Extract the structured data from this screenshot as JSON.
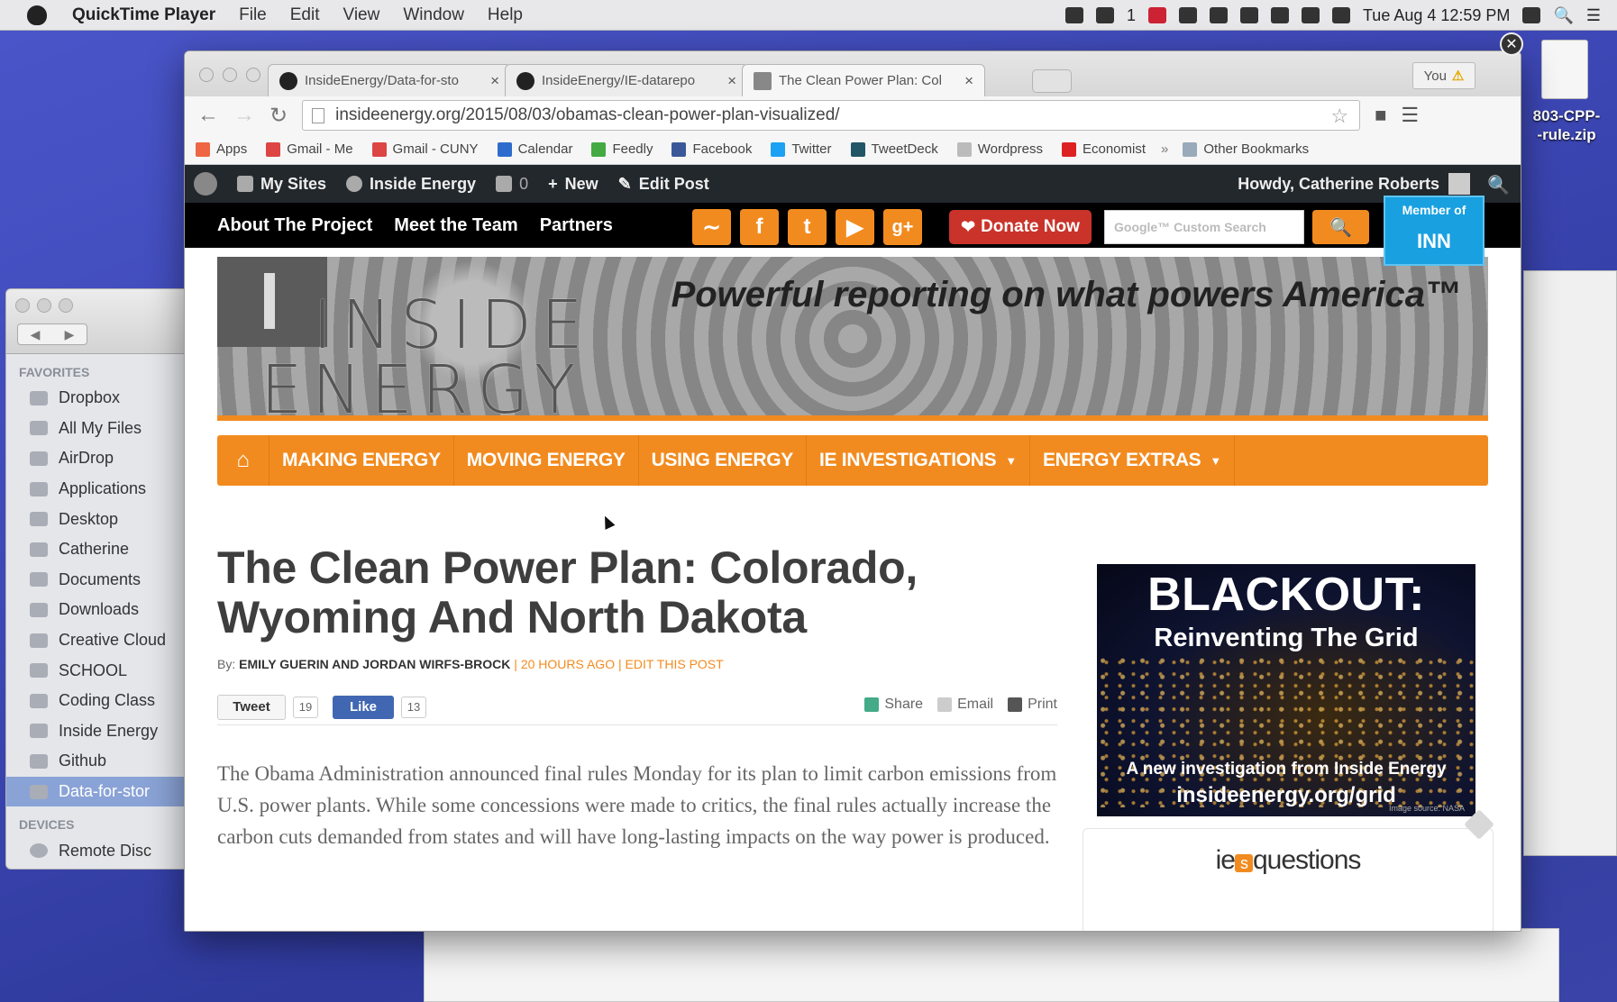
{
  "menubar": {
    "app_name": "QuickTime Player",
    "menus": [
      "File",
      "Edit",
      "View",
      "Window",
      "Help"
    ],
    "clock": "Tue Aug 4  12:59 PM",
    "tray_badge": "1"
  },
  "desktop_file": {
    "label_line1": "803-CPP-",
    "label_line2": "-rule.zip"
  },
  "finder": {
    "favorites_header": "FAVORITES",
    "items": [
      "Dropbox",
      "All My Files",
      "AirDrop",
      "Applications",
      "Desktop",
      "Catherine",
      "Documents",
      "Downloads",
      "Creative Cloud",
      "SCHOOL",
      "Coding Class",
      "Inside Energy",
      "Github",
      "Data-for-stor"
    ],
    "devices_header": "DEVICES",
    "device": "Remote Disc"
  },
  "chrome": {
    "tabs": [
      {
        "title": "InsideEnergy/Data-for-sto"
      },
      {
        "title": "InsideEnergy/IE-datarepo"
      },
      {
        "title": "The Clean Power Plan: Col"
      }
    ],
    "profile": "You",
    "url": "insideenergy.org/2015/08/03/obamas-clean-power-plan-visualized/",
    "bookmarks": [
      "Apps",
      "Gmail - Me",
      "Gmail - CUNY",
      "Calendar",
      "Feedly",
      "Facebook",
      "Twitter",
      "TweetDeck",
      "Wordpress",
      "Economist"
    ],
    "bookmark_colors": [
      "#e64",
      "#d44",
      "#d44",
      "#2d6ccd",
      "#4a4",
      "#3b5998",
      "#1da1f2",
      "#256",
      "#bbb",
      "#d22"
    ],
    "other_bookmarks": "Other Bookmarks"
  },
  "wpbar": {
    "my_sites": "My Sites",
    "site": "Inside Energy",
    "comments": "0",
    "new": "New",
    "edit": "Edit Post",
    "howdy": "Howdy, Catherine Roberts"
  },
  "ienav": {
    "links": [
      "About The Project",
      "Meet the Team",
      "Partners"
    ],
    "donate": "Donate Now",
    "search_placeholder": "Google™ Custom Search",
    "member_of": "Member of",
    "inn": "INN"
  },
  "banner": {
    "wordmark_1": "INSIDE",
    "wordmark_2": "ENERGY",
    "tagline": "Powerful reporting on what powers America™"
  },
  "catnav": [
    "MAKING ENERGY",
    "MOVING ENERGY",
    "USING ENERGY",
    "IE INVESTIGATIONS",
    "ENERGY EXTRAS"
  ],
  "article": {
    "title": "The Clean Power Plan: Colorado, Wyoming And North Dakota",
    "by": "By:",
    "authors": "EMILY GUERIN AND JORDAN WIRFS-BROCK",
    "time": "20 HOURS AGO",
    "edit": "EDIT THIS POST",
    "tweet": "Tweet",
    "tweet_count": "19",
    "like": "Like",
    "like_count": "13",
    "share": "Share",
    "email": "Email",
    "print": "Print",
    "lede": "The Obama Administration announced final rules Monday for its plan to limit carbon emissions from U.S. power plants. While some concessions were made to critics, the final rules actually increase the carbon cuts demanded from states and will have long-lasting impacts on the way power is produced."
  },
  "sidebar_ad": {
    "title": "BLACKOUT:",
    "subtitle": "Reinventing The Grid",
    "line1": "A new investigation from Inside Energy",
    "line2": "insideenergy.org/grid",
    "credit": "Image source: NASA"
  },
  "questions": {
    "prefix": "ie",
    "badge": "s",
    "text": "questions"
  }
}
